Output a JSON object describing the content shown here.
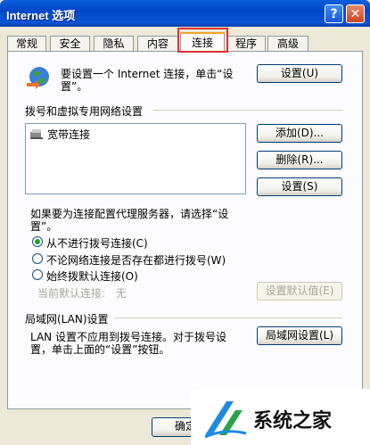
{
  "window": {
    "title": "Internet 选项",
    "help_label": "?",
    "close_label": "✕"
  },
  "tabs": [
    "常规",
    "安全",
    "隐私",
    "内容",
    "连接",
    "程序",
    "高级"
  ],
  "active_tab": "连接",
  "setup": {
    "text_line1": "要设置一个 Internet 连接，单击“设",
    "text_line2": "置”。",
    "button": "设置(U)",
    "icon": "globe-icon"
  },
  "dialup": {
    "heading": "拨号和虚拟专用网络设置",
    "items": [
      "宽带连接"
    ],
    "add_button": "添加(D)...",
    "delete_button": "删除(R)...",
    "settings_button": "设置(S)",
    "proxy_text_line1": "如果要为连接配置代理服务器，请选择“设",
    "proxy_text_line2": "置”。",
    "options": [
      {
        "label": "从不进行拨号连接(C)",
        "checked": true
      },
      {
        "label": "不论网络连接是否存在都进行拨号(W)",
        "checked": false
      },
      {
        "label": "始终拨默认连接(O)",
        "checked": false
      }
    ],
    "current_default_label": "当前默认连接:",
    "current_default_value": "无",
    "set_default_button": "设置默认值(E)"
  },
  "lan": {
    "heading": "局域网(LAN)设置",
    "text_line1": "LAN 设置不应用到拨号连接。对于拨号设",
    "text_line2": "置，单击上面的“设置”按钮。",
    "button": "局域网设置(L)"
  },
  "footer": {
    "ok_button": "确定"
  },
  "watermark": {
    "text": "系统之家"
  },
  "colors": {
    "titlebar": "#0A55D8",
    "active_tab_highlight": "#F1A32F",
    "annotation_box": "#E03030",
    "radio_dot": "#21A121"
  }
}
